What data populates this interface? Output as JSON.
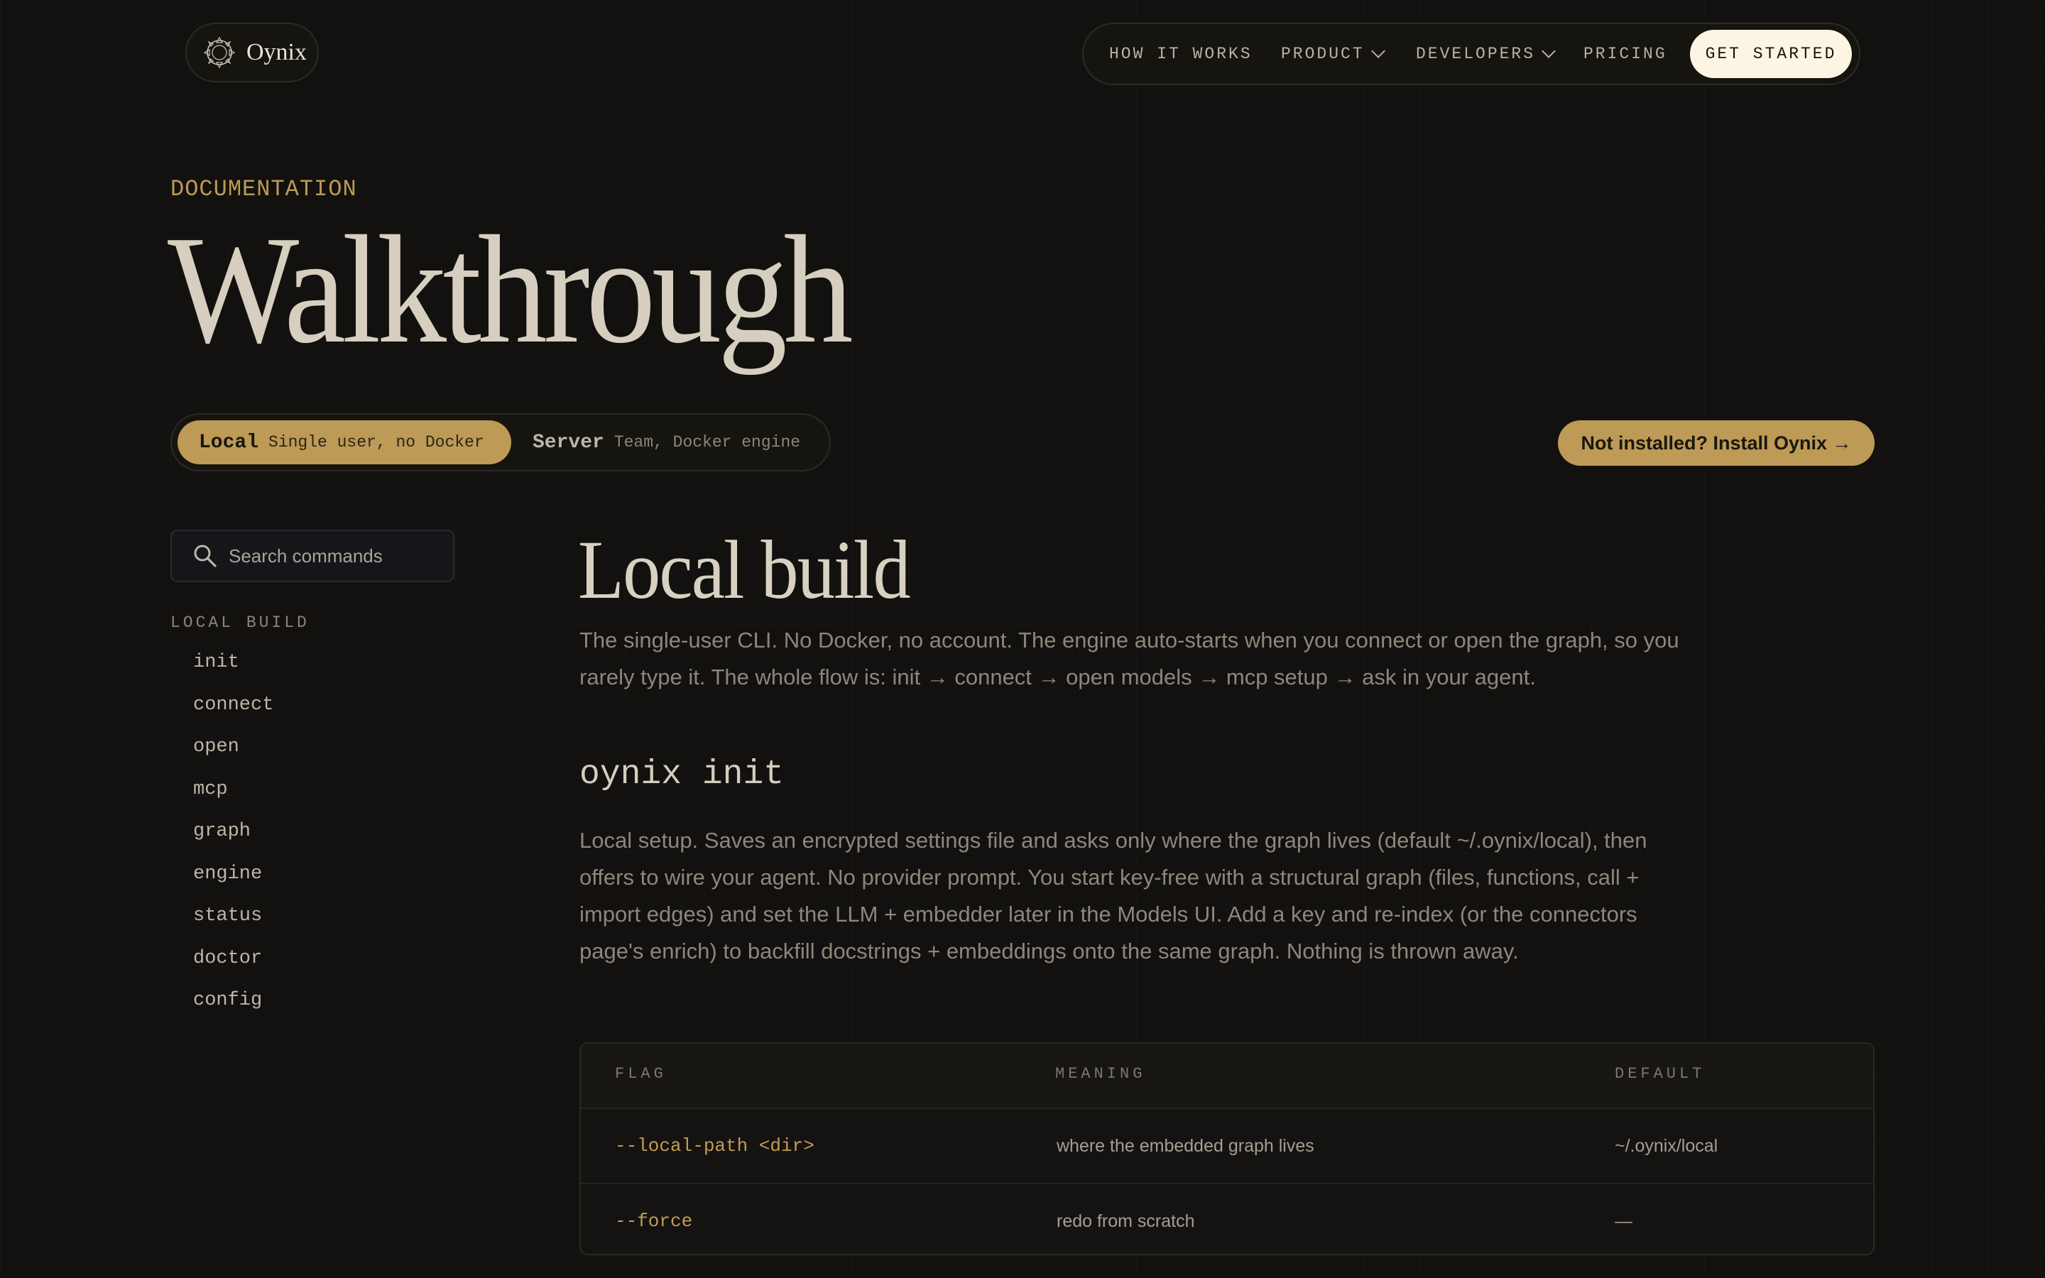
{
  "brand": {
    "name": "Oynix"
  },
  "nav": {
    "items": [
      {
        "label": "HOW IT WORKS",
        "has_menu": false
      },
      {
        "label": "PRODUCT",
        "has_menu": true
      },
      {
        "label": "DEVELOPERS",
        "has_menu": true
      },
      {
        "label": "PRICING",
        "has_menu": false
      }
    ],
    "cta_label": "GET STARTED"
  },
  "hero": {
    "eyebrow": "DOCUMENTATION",
    "title": "Walkthrough"
  },
  "mode": {
    "local": {
      "name": "Local",
      "desc": "Single user, no Docker",
      "selected": true
    },
    "server": {
      "name": "Server",
      "desc": "Team, Docker engine",
      "selected": false
    }
  },
  "install_label": "Not installed? Install Oynix →",
  "sidebar": {
    "search_placeholder": "Search commands",
    "section_label": "LOCAL BUILD",
    "items": [
      "init",
      "connect",
      "open",
      "mcp",
      "graph",
      "engine",
      "status",
      "doctor",
      "config"
    ]
  },
  "main": {
    "title": "Local build",
    "lead": "The single-user CLI. No Docker, no account. The engine auto-starts when you connect or open the graph, so you rarely type it. The whole flow is: init → connect → open models → mcp setup → ask in your agent.",
    "command_title": "oynix init",
    "command_body": "Local setup. Saves an encrypted settings file and asks only where the graph lives (default ~/.oynix/local), then offers to wire your agent. No provider prompt. You start key-free with a structural graph (files, functions, call + import edges) and set the LLM + embedder later in the Models UI. Add a key and re-index (or the connectors page's enrich) to backfill docstrings + embeddings onto the same graph. Nothing is thrown away.",
    "table": {
      "headers": [
        "FLAG",
        "MEANING",
        "DEFAULT"
      ],
      "rows": [
        {
          "flag": "--local-path <dir>",
          "meaning": "where the embedded graph lives",
          "default": "~/.oynix/local"
        },
        {
          "flag": "--force",
          "meaning": "redo from scratch",
          "default": "—"
        }
      ]
    }
  },
  "colors": {
    "background": "#12110f",
    "accent": "#bd9a55",
    "cta_bg": "#fdf5e4",
    "text_primary": "#d6cfbf",
    "text_muted": "#8d877b"
  },
  "icons": {
    "logo": "oynix-mark-icon",
    "search": "search-icon",
    "menu": "chevron-down-icon"
  }
}
